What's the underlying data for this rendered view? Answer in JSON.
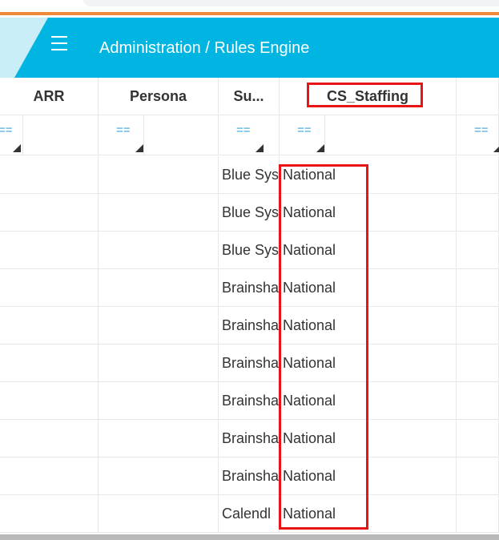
{
  "header": {
    "title": "Administration / Rules Engine",
    "bg_color": "#00b5e2",
    "menu_icon": "hamburger-menu-icon"
  },
  "columns": [
    {
      "key": "arr",
      "label": "ARR"
    },
    {
      "key": "persona",
      "label": "Persona"
    },
    {
      "key": "sub",
      "label": "Su..."
    },
    {
      "key": "cs_staffing",
      "label": "CS_Staffing"
    },
    {
      "key": "next",
      "label": ""
    }
  ],
  "filter_icon_text": "==",
  "rows": [
    {
      "sub": "Blue Sys",
      "cs_staffing": "National"
    },
    {
      "sub": "Blue Sys",
      "cs_staffing": "National"
    },
    {
      "sub": "Blue Sys",
      "cs_staffing": "National"
    },
    {
      "sub": "Brainsha",
      "cs_staffing": "National"
    },
    {
      "sub": "Brainsha",
      "cs_staffing": "National"
    },
    {
      "sub": "Brainsha",
      "cs_staffing": "National"
    },
    {
      "sub": "Brainsha",
      "cs_staffing": "National"
    },
    {
      "sub": "Brainsha",
      "cs_staffing": "National"
    },
    {
      "sub": "Brainsha",
      "cs_staffing": "National"
    },
    {
      "sub": "Calendl",
      "cs_staffing": "National"
    }
  ],
  "highlight_color": "#e81416"
}
